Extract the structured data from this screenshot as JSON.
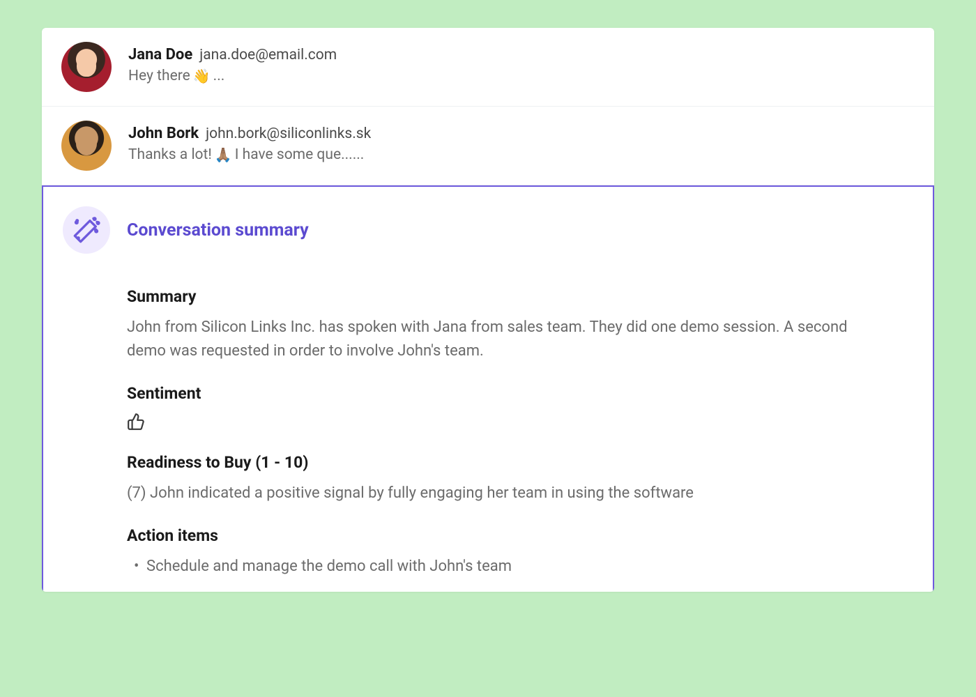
{
  "messages": [
    {
      "name": "Jana Doe",
      "email": "jana.doe@email.com",
      "preview_before": "Hey there ",
      "preview_emoji": "👋",
      "preview_after": "..."
    },
    {
      "name": "John Bork",
      "email": "john.bork@siliconlinks.sk",
      "preview_before": "Thanks a lot! ",
      "preview_emoji": "🙏🏽",
      "preview_after": " I have some que......"
    }
  ],
  "summary": {
    "title": "Conversation summary",
    "sections": {
      "summary": {
        "heading": "Summary",
        "text": "John from Silicon Links Inc. has spoken with Jana from sales team. They did one demo session. A second demo was requested in order to involve John's team."
      },
      "sentiment": {
        "heading": "Sentiment",
        "icon": "thumbs-up"
      },
      "readiness": {
        "heading": "Readiness to Buy (1 - 10)",
        "text": "(7) John indicated a positive signal by fully engaging her team in using the software"
      },
      "action_items": {
        "heading": "Action items",
        "items": [
          "Schedule and manage the demo call with John's team"
        ]
      }
    }
  }
}
